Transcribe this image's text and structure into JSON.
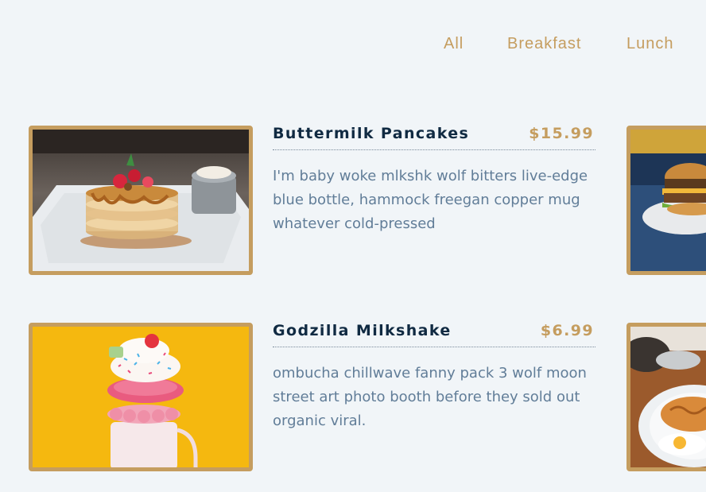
{
  "filters": [
    "All",
    "Breakfast",
    "Lunch"
  ],
  "menu": [
    {
      "name": "Buttermilk Pancakes",
      "price": "$15.99",
      "desc": "I'm baby woke mlkshk wolf bitters live-edge blue bottle, hammock freegan copper mug whatever cold-pressed"
    },
    {
      "name": "Godzilla Milkshake",
      "price": "$6.99",
      "desc": "ombucha chillwave fanny pack 3 wolf moon street art photo booth before they sold out organic viral."
    }
  ],
  "colors": {
    "accent": "#c59d5f",
    "title": "#102a42",
    "text": "#617d98",
    "background": "#f1f5f8"
  }
}
